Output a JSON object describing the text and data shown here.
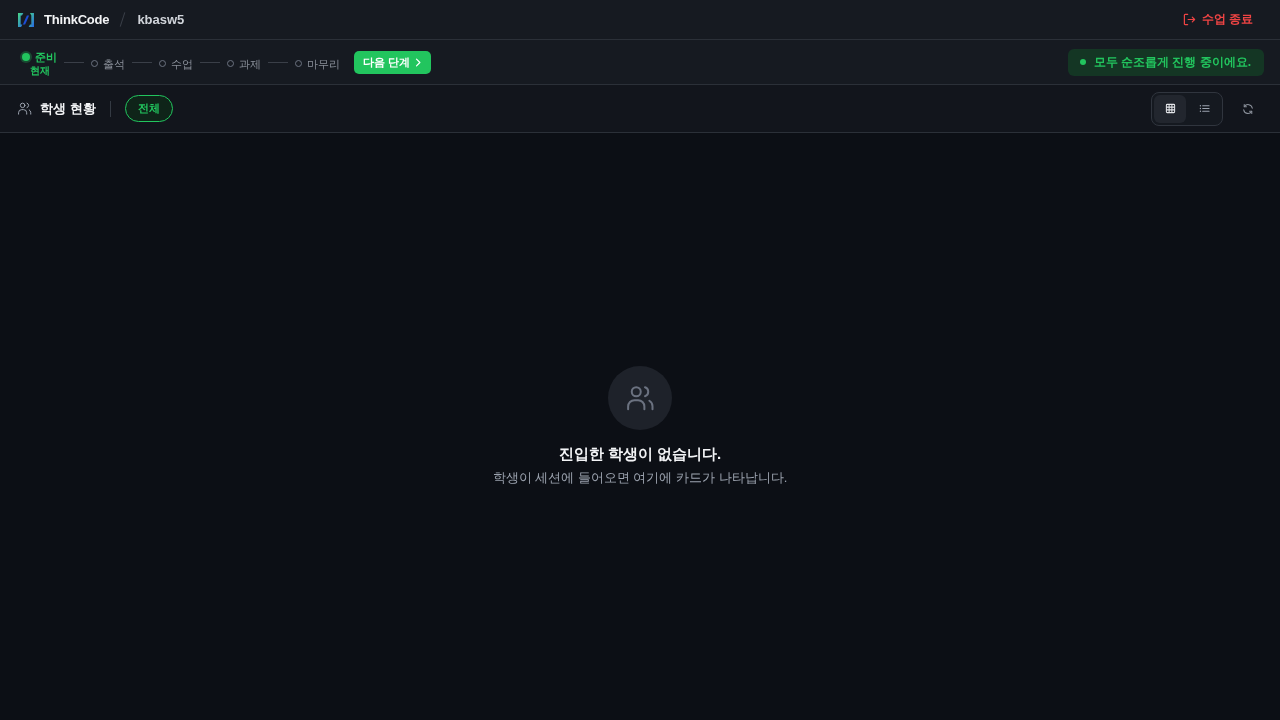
{
  "header": {
    "brand": "ThinkCode",
    "session": "kbasw5",
    "end_button": "수업 종료"
  },
  "steps": {
    "items": [
      {
        "label": "준비",
        "current": true,
        "sublabel": "현재"
      },
      {
        "label": "출석",
        "current": false
      },
      {
        "label": "수업",
        "current": false
      },
      {
        "label": "과제",
        "current": false
      },
      {
        "label": "마무리",
        "current": false
      }
    ],
    "next_button": "다음 단계"
  },
  "status": {
    "message": "모두 순조롭게 진행 중이에요."
  },
  "toolbar": {
    "title": "학생 현황",
    "filters": [
      {
        "label": "전체",
        "selected": true
      }
    ],
    "views": [
      {
        "kind": "grid",
        "selected": true
      },
      {
        "kind": "list",
        "selected": false
      }
    ]
  },
  "empty_state": {
    "title": "진입한 학생이 없습니다.",
    "message": "학생이 세션에 들어오면 여기에 카드가 나타납니다."
  }
}
